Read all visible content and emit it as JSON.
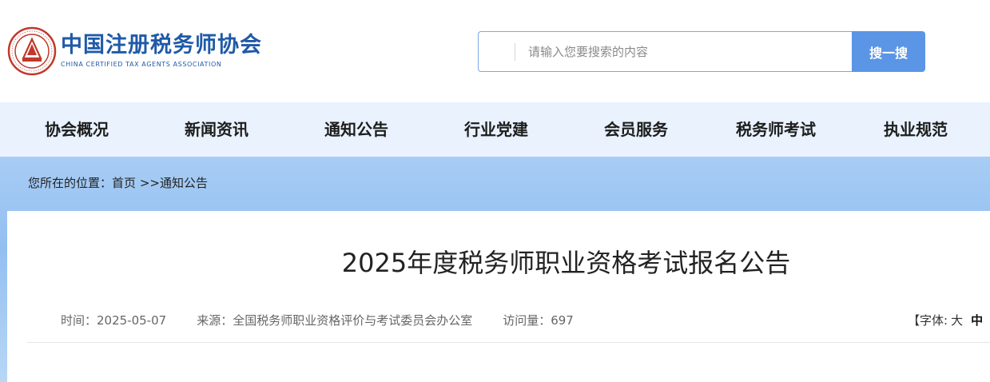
{
  "logo": {
    "cn": "中国注册税务师协会",
    "en": "CHINA CERTIFIED TAX AGENTS ASSOCIATION"
  },
  "search": {
    "placeholder": "请输入您要搜索的内容",
    "value": "",
    "button_label": "搜一搜"
  },
  "nav": {
    "items": [
      {
        "label": "协会概况"
      },
      {
        "label": "新闻资讯"
      },
      {
        "label": "通知公告"
      },
      {
        "label": "行业党建"
      },
      {
        "label": "会员服务"
      },
      {
        "label": "税务师考试"
      },
      {
        "label": "执业规范"
      }
    ]
  },
  "breadcrumb": {
    "prefix": "您所在的位置：",
    "home": "首页",
    "current": ">>通知公告"
  },
  "article": {
    "title": "2025年度税务师职业资格考试报名公告",
    "time": "时间：2025-05-07",
    "source": "来源：全国税务师职业资格评价与考试委员会办公室",
    "views": "访问量：697",
    "font_label": "【字体: ",
    "font_large": "大",
    "font_medium": "中"
  },
  "colors": {
    "brand_blue": "#1f5aa8",
    "search_button": "#5b95e6",
    "nav_bg": "#e9f2fd",
    "band_bg": "#93bff0",
    "emblem_red": "#c0392b"
  }
}
